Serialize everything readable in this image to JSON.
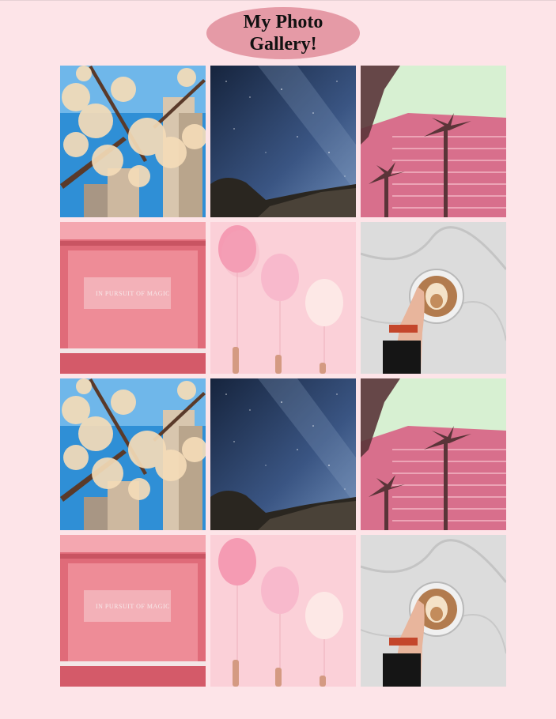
{
  "header": {
    "title": "My Photo Gallery!"
  },
  "gallery": {
    "photos": [
      {
        "subject": "cherry-blossom-buildings"
      },
      {
        "subject": "starry-night-sky"
      },
      {
        "subject": "pink-building-palm-trees"
      },
      {
        "subject": "pink-wall-sign",
        "sign_text": "IN PURSUIT OF MAGIC"
      },
      {
        "subject": "pink-balloons"
      },
      {
        "subject": "latte-coffee-marble"
      },
      {
        "subject": "cherry-blossom-buildings"
      },
      {
        "subject": "starry-night-sky"
      },
      {
        "subject": "pink-building-palm-trees"
      },
      {
        "subject": "pink-wall-sign",
        "sign_text": "IN PURSUIT OF MAGIC"
      },
      {
        "subject": "pink-balloons"
      },
      {
        "subject": "latte-coffee-marble"
      }
    ]
  },
  "colors": {
    "page_background": "#fde4e8",
    "title_oval": "#e59aa6"
  }
}
